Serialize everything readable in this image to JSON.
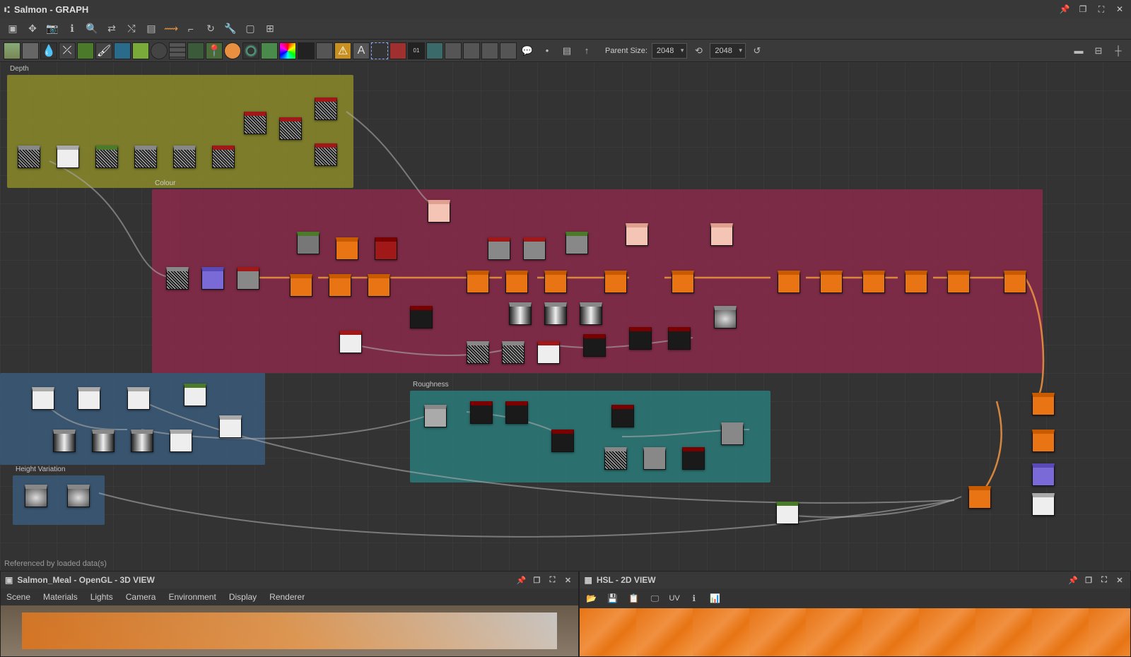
{
  "titlebar": {
    "title": "Salmon - GRAPH"
  },
  "parentSizeLabel": "Parent Size:",
  "parentSizeW": "2048",
  "parentSizeH": "2048",
  "frames": {
    "depth": "Depth",
    "colour": "Colour",
    "roughness": "Roughness",
    "heightvar": "Height Variation"
  },
  "statusText": "Referenced by loaded data(s)",
  "panel3d": {
    "title": "Salmon_Meal - OpenGL - 3D VIEW",
    "menu": {
      "scene": "Scene",
      "materials": "Materials",
      "lights": "Lights",
      "camera": "Camera",
      "environment": "Environment",
      "display": "Display",
      "renderer": "Renderer"
    }
  },
  "panel2d": {
    "title": "HSL - 2D VIEW",
    "uv": "UV"
  }
}
